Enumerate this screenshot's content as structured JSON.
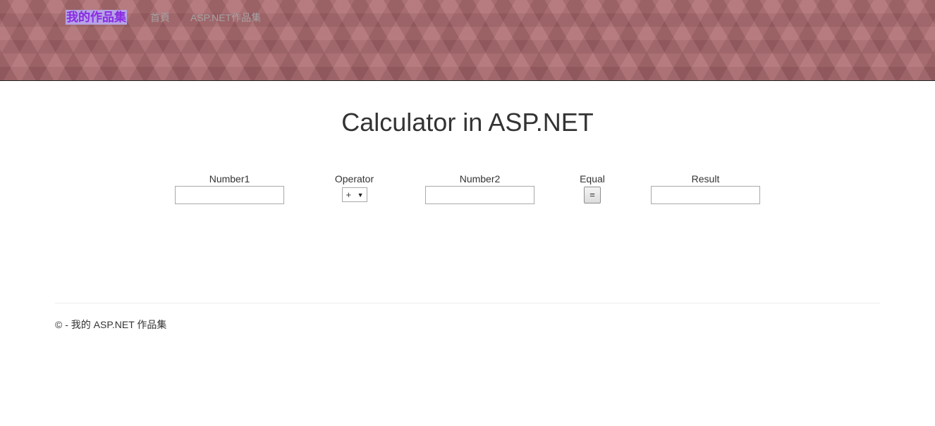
{
  "navbar": {
    "brand": "我的作品集",
    "links": [
      "首頁",
      "ASP.NET作品集"
    ]
  },
  "page": {
    "title": "Calculator in ASP.NET"
  },
  "calculator": {
    "number1_label": "Number1",
    "number1_value": "",
    "operator_label": "Operator",
    "operator_selected": "+",
    "number2_label": "Number2",
    "number2_value": "",
    "equal_label": "Equal",
    "equal_button": "=",
    "result_label": "Result",
    "result_value": ""
  },
  "footer": {
    "text": "© - 我的 ASP.NET 作品集"
  },
  "colors": {
    "brand_text": "#8a2be2",
    "brand_highlight": "#b7a3e6",
    "navbar_bg": "#ad6a6f",
    "nav_link": "#a7a2a4"
  }
}
